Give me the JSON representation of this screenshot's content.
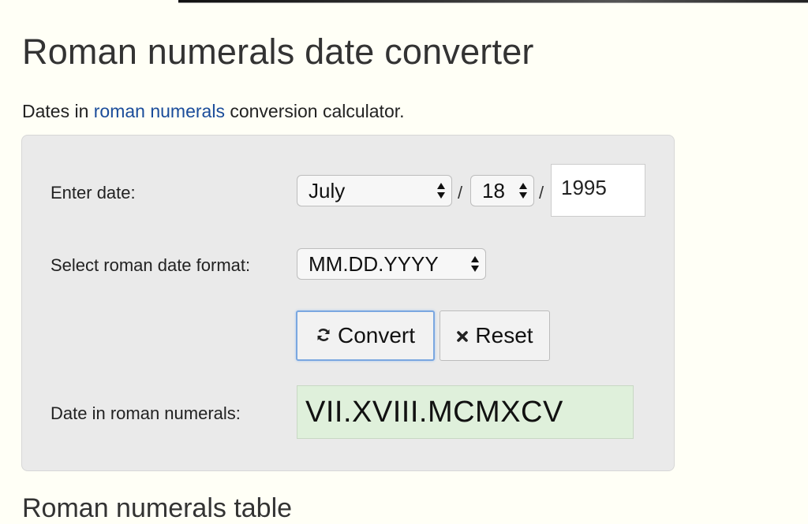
{
  "page": {
    "title": "Roman numerals date converter",
    "intro_before": "Dates in ",
    "intro_link": "roman numerals",
    "intro_after": " conversion calculator.",
    "next_heading": "Roman numerals table"
  },
  "form": {
    "enter_date_label": "Enter date:",
    "month_value": "July",
    "day_value": "18",
    "year_value": "1995",
    "separator": "/",
    "format_label": "Select roman date format:",
    "format_value": "MM.DD.YYYY",
    "convert_label": "Convert",
    "reset_label": "Reset",
    "result_label": "Date in roman numerals:",
    "result_value": "VII.XVIII.MCMXCV"
  },
  "icons": {
    "convert": "refresh-icon",
    "reset": "close-icon",
    "select": "up-down-arrows-icon"
  },
  "colors": {
    "link": "#1a4c9a",
    "result_bg": "#dff0db",
    "panel_bg": "#eaeaea",
    "page_bg": "#fffff6",
    "convert_focus": "#7aa7e0"
  }
}
